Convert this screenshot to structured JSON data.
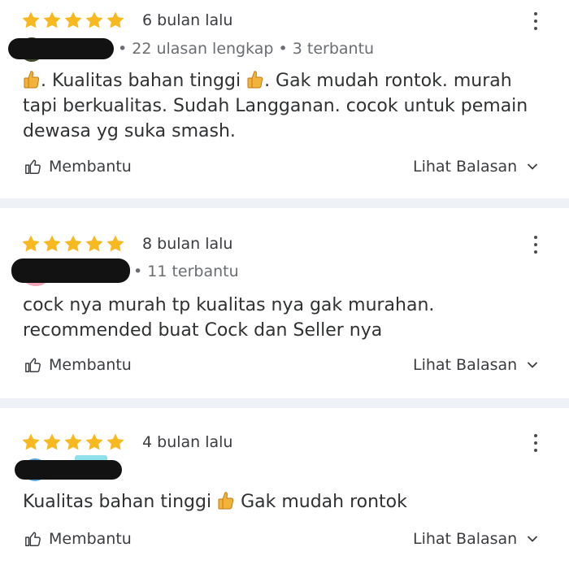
{
  "icons": {
    "star": "star-icon",
    "more": "more-vertical-icon",
    "helpful": "thumbs-up-outline-icon",
    "expand": "chevron-down-icon",
    "emoji": "thumbs-up-emoji-icon"
  },
  "colors": {
    "star": "#f8b81f",
    "separator": "#eef1f6",
    "text": "#2f3133",
    "meta": "#6a6d72"
  },
  "reviews": [
    {
      "rating": 5,
      "date": "6 bulan lalu",
      "meta": "• 22 ulasan lengkap • 3 terbantu",
      "text_parts": [
        ". Kualitas bahan tinggi ",
        ". Gak mudah rontok.  murah tapi berkualitas. Sudah Langganan. cocok untuk pemain dewasa yg suka smash."
      ],
      "helpful_label": "Membantu",
      "reply_label": "Lihat Balasan"
    },
    {
      "rating": 5,
      "date": "8 bulan lalu",
      "meta": "• 11 terbantu",
      "text": "cock nya murah tp kualitas nya gak murahan. recommended buat Cock dan Seller nya",
      "helpful_label": "Membantu",
      "reply_label": "Lihat Balasan"
    },
    {
      "rating": 5,
      "date": "4 bulan lalu",
      "meta": "",
      "text_parts": [
        "Kualitas bahan tinggi ",
        " Gak mudah rontok"
      ],
      "helpful_label": "Membantu",
      "reply_label": "Lihat Balasan"
    }
  ]
}
